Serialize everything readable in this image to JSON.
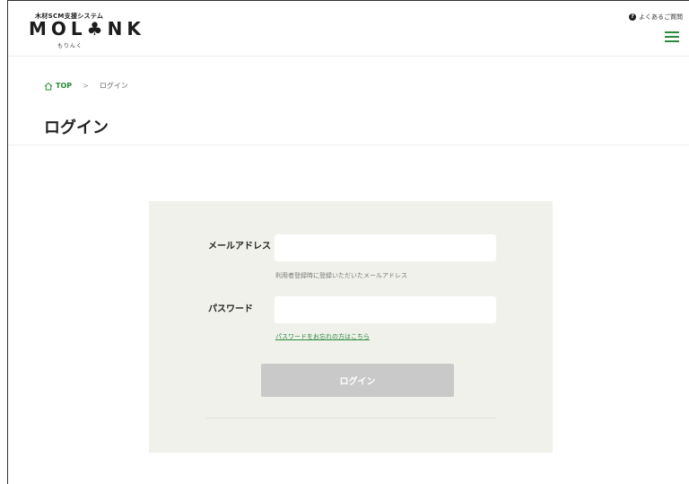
{
  "header": {
    "logo_sub": "木材SCM支援システム",
    "logo_main": "MOL♣NK",
    "logo_kana": "もりんく",
    "faq_label": "よくあるご質問"
  },
  "breadcrumb": {
    "home": "TOP",
    "separator": ">",
    "current": "ログイン"
  },
  "page": {
    "title": "ログイン"
  },
  "form": {
    "email_label": "メールアドレス",
    "email_value": "",
    "email_placeholder": "",
    "email_hint": "利用者登録時に登録いただいたメールアドレス",
    "password_label": "パスワード",
    "password_value": "",
    "password_placeholder": "",
    "forgot_link": "パスワードをお忘れの方はこちら",
    "submit_label": "ログイン"
  },
  "colors": {
    "accent": "#2c8a3c",
    "card_bg": "#f1f1ec",
    "button_disabled": "#c9c9c9"
  },
  "icons": {
    "home": "home-icon",
    "faq": "question-circle-icon",
    "menu": "hamburger-menu-icon"
  }
}
